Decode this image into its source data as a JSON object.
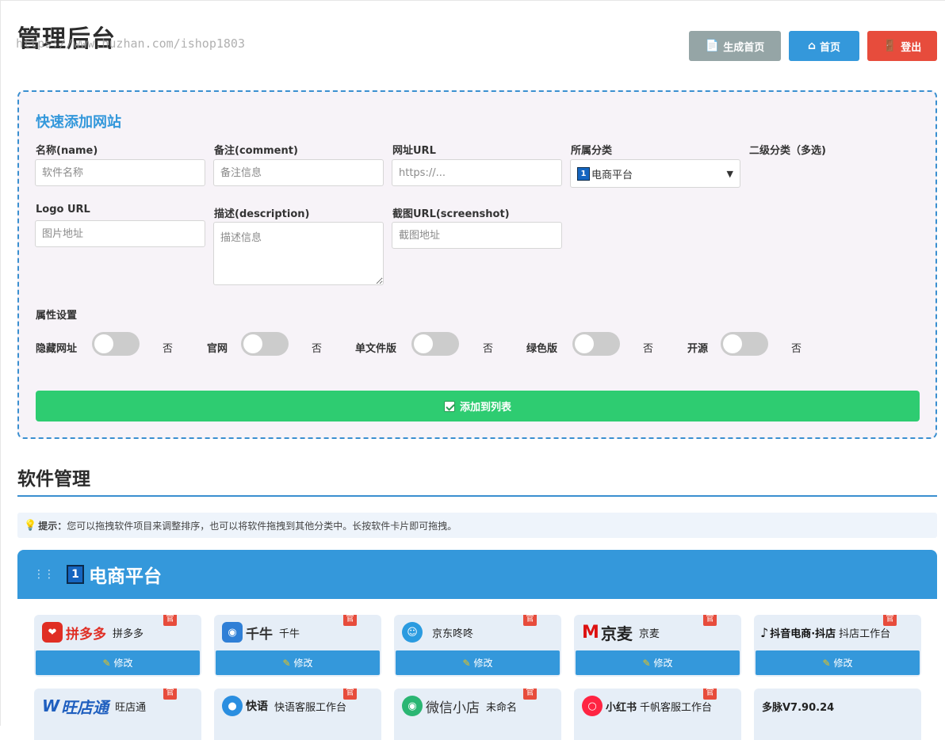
{
  "header": {
    "title": "管理后台",
    "watermark": "https://www.huzhan.com/ishop1803",
    "buttons": {
      "generate": "生成首页",
      "home": "首页",
      "logout": "登出"
    }
  },
  "quick_add": {
    "title": "快速添加网站",
    "fields": {
      "name": {
        "label": "名称(name)",
        "placeholder": "软件名称"
      },
      "comment": {
        "label": "备注(comment)",
        "placeholder": "备注信息"
      },
      "url": {
        "label": "网址URL",
        "placeholder": "https://..."
      },
      "category": {
        "label": "所属分类",
        "selected": "电商平台",
        "selected_badge": "1"
      },
      "subcategory": {
        "label": "二级分类（多选)"
      },
      "logo": {
        "label": "Logo URL",
        "placeholder": "图片地址"
      },
      "description": {
        "label": "描述(description)",
        "placeholder": "描述信息"
      },
      "screenshot": {
        "label": "截图URL(screenshot)",
        "placeholder": "截图地址"
      }
    },
    "attributes_label": "属性设置",
    "toggles": [
      {
        "label": "隐藏网址",
        "state": "否",
        "on": false
      },
      {
        "label": "官网",
        "state": "否",
        "on": false
      },
      {
        "label": "单文件版",
        "state": "否",
        "on": false
      },
      {
        "label": "绿色版",
        "state": "否",
        "on": false
      },
      {
        "label": "开源",
        "state": "否",
        "on": false
      }
    ],
    "submit_label": "添加到列表"
  },
  "software": {
    "title": "软件管理",
    "tip_prefix": "提示：",
    "tip_text": "您可以拖拽软件项目来调整排序，也可以将软件拖拽到其他分类中。长按软件卡片即可拖拽。",
    "category": {
      "badge": "1",
      "name": "电商平台"
    },
    "edit_label": "修改",
    "official_badge": "官",
    "cards": [
      {
        "logo_text": "拼多多",
        "name": "拼多多",
        "official": true
      },
      {
        "logo_text": "千牛",
        "name": "千牛",
        "official": true
      },
      {
        "logo_text": "",
        "name": "京东咚咚",
        "official": true
      },
      {
        "logo_text": "京麦",
        "name": "京麦",
        "official": true
      },
      {
        "logo_text": "抖音电商·抖店",
        "name": "抖店工作台",
        "official": true
      },
      {
        "logo_text": "旺店通",
        "name": "旺店通",
        "official": true
      },
      {
        "logo_text": "快语",
        "name": "快语客服工作台",
        "official": true
      },
      {
        "logo_text": "微信小店",
        "name": "未命名",
        "official": true
      },
      {
        "logo_text": "小红书",
        "name": "千帆客服工作台",
        "official": true
      },
      {
        "logo_text": "",
        "name": "多脉V7.90.24",
        "official": false
      }
    ]
  },
  "colors": {
    "primary": "#3498db",
    "success": "#2ecc71",
    "danger": "#e74c3c",
    "secondary": "#95a5a6"
  }
}
